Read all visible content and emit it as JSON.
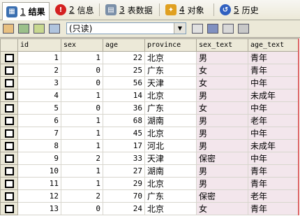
{
  "tabs": [
    {
      "num": "1",
      "label": "结果",
      "icon": "grid-icon",
      "active": true
    },
    {
      "num": "2",
      "label": "信息",
      "icon": "info-icon"
    },
    {
      "num": "3",
      "label": "表数据",
      "icon": "table-data-icon"
    },
    {
      "num": "4",
      "label": "对象",
      "icon": "objects-icon"
    },
    {
      "num": "5",
      "label": "历史",
      "icon": "history-icon"
    }
  ],
  "toolbar": {
    "mode_select": "(只读)"
  },
  "columns": [
    "id",
    "sex",
    "age",
    "province",
    "sex_text",
    "age_text"
  ],
  "rows": [
    [
      "1",
      "1",
      "22",
      "北京",
      "男",
      "青年"
    ],
    [
      "2",
      "0",
      "25",
      "广东",
      "女",
      "青年"
    ],
    [
      "3",
      "0",
      "56",
      "天津",
      "女",
      "中年"
    ],
    [
      "4",
      "1",
      "14",
      "北京",
      "男",
      "未成年"
    ],
    [
      "5",
      "0",
      "36",
      "广东",
      "女",
      "中年"
    ],
    [
      "6",
      "1",
      "68",
      "湖南",
      "男",
      "老年"
    ],
    [
      "7",
      "1",
      "45",
      "北京",
      "男",
      "中年"
    ],
    [
      "8",
      "1",
      "17",
      "河北",
      "男",
      "未成年"
    ],
    [
      "9",
      "2",
      "33",
      "天津",
      "保密",
      "中年"
    ],
    [
      "10",
      "1",
      "27",
      "湖南",
      "男",
      "青年"
    ],
    [
      "11",
      "1",
      "29",
      "北京",
      "男",
      "青年"
    ],
    [
      "12",
      "2",
      "70",
      "广东",
      "保密",
      "老年"
    ],
    [
      "13",
      "0",
      "24",
      "北京",
      "女",
      "青年"
    ]
  ]
}
